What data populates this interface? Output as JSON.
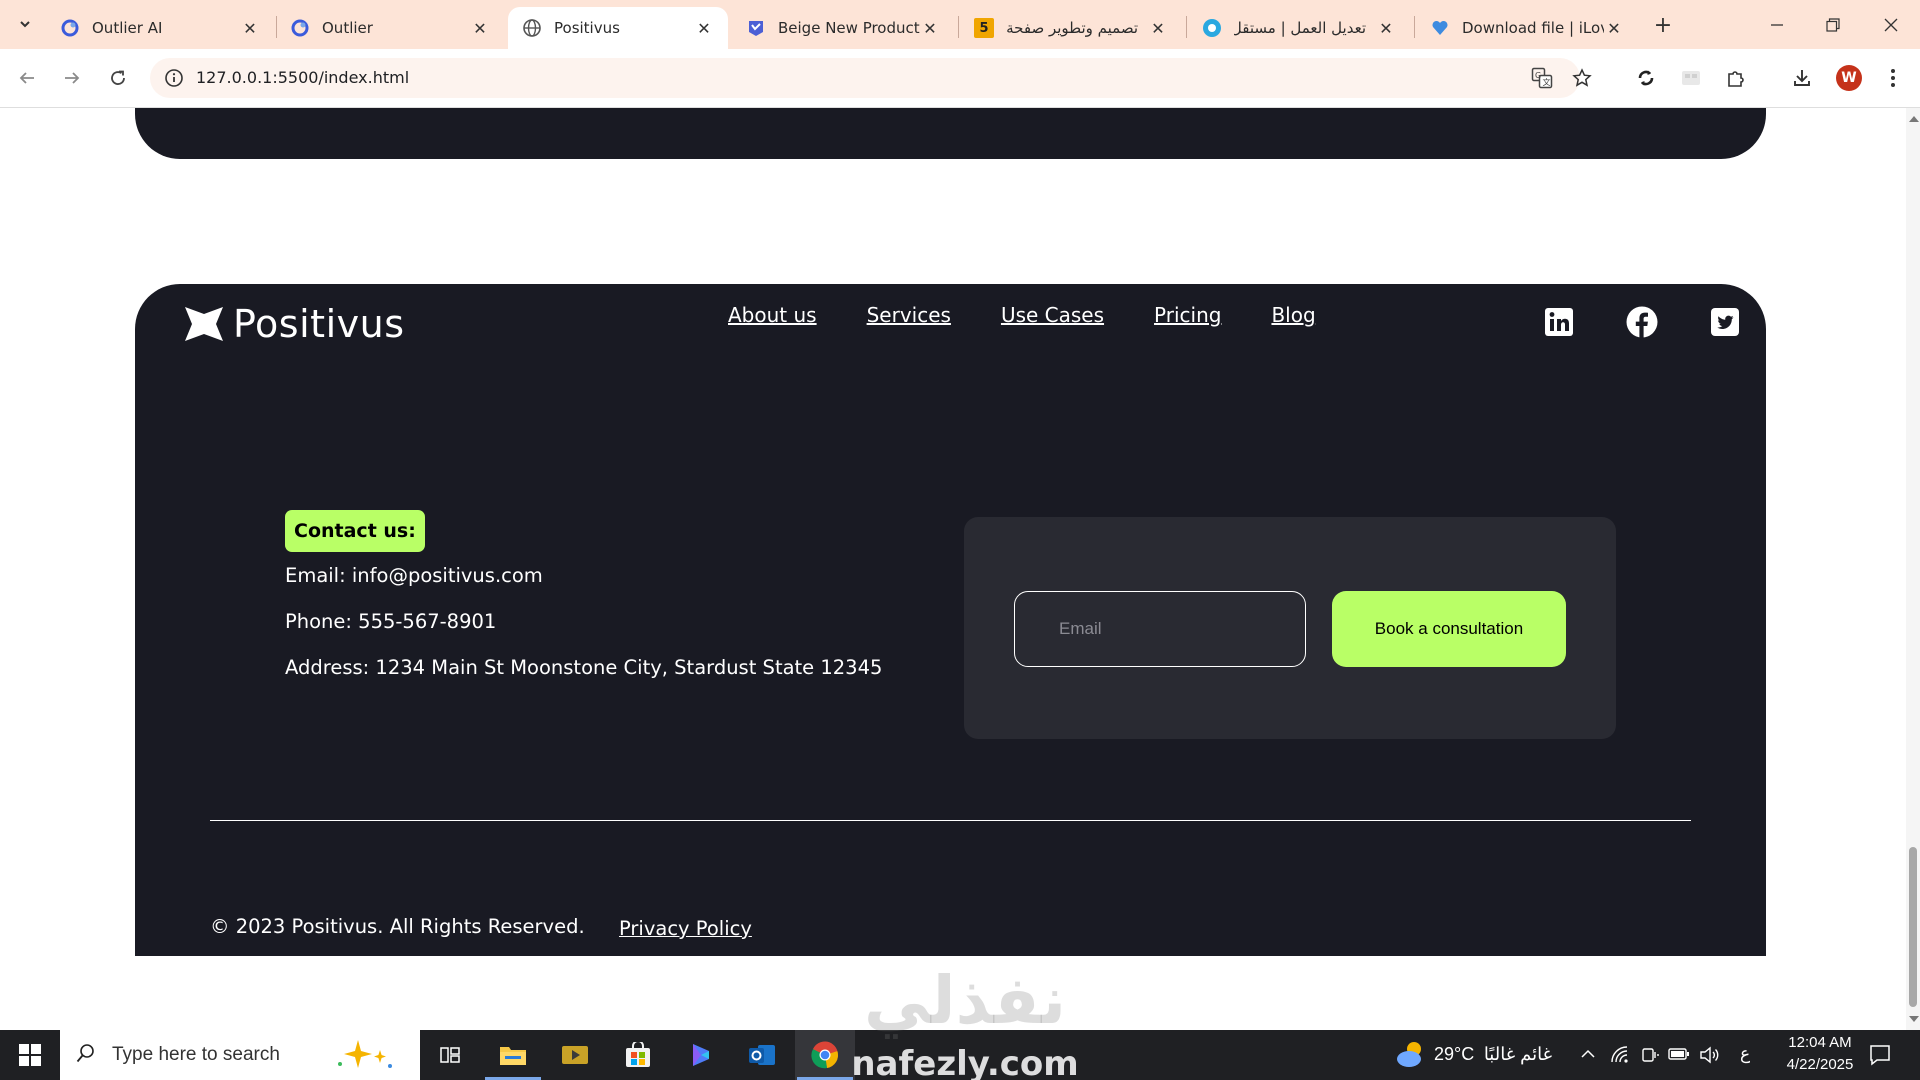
{
  "browser": {
    "tabs": [
      {
        "title": "Outlier AI",
        "favicon": "outlier-icon"
      },
      {
        "title": "Outlier",
        "favicon": "outlier-icon"
      },
      {
        "title": "Positivus",
        "favicon": "globe-icon",
        "active": true
      },
      {
        "title": "Beige New Product N",
        "favicon": "canva-icon"
      },
      {
        "title": "تصميم وتطوير صفحة",
        "favicon": "badge-5-icon",
        "badge": "5"
      },
      {
        "title": "تعديل العمل | مستقل",
        "favicon": "mostaql-icon"
      },
      {
        "title": "Download file | iLove",
        "favicon": "ilovepdf-icon"
      }
    ],
    "url": "127.0.0.1:5500/index.html",
    "profile_initial": "W"
  },
  "page": {
    "logo_text": "Positivus",
    "nav": [
      "About us",
      "Services",
      "Use Cases",
      "Pricing",
      "Blog"
    ],
    "social": [
      "linkedin-icon",
      "facebook-icon",
      "twitter-icon"
    ],
    "contact": {
      "badge": "Contact us:",
      "email": "Email: info@positivus.com",
      "phone": "Phone: 555-567-8901",
      "address": "Address: 1234 Main St Moonstone City, Stardust State 12345"
    },
    "subscribe": {
      "email_placeholder": "Email",
      "button_label": "Book a consultation"
    },
    "copyright": "© 2023 Positivus. All Rights Reserved.",
    "privacy_link": "Privacy Policy"
  },
  "colors": {
    "dark": "#191a23",
    "accent": "#b9ff66",
    "card": "#292a32",
    "tabstrip": "#fde4d7"
  },
  "watermark": {
    "arabic": "نفذلي",
    "latin": "nafezly.com"
  },
  "taskbar": {
    "search_placeholder": "Type here to search",
    "weather_temp": "29°C",
    "weather_desc": "غائم غالبًا",
    "lang": "ع",
    "time": "12:04 AM",
    "date": "4/22/2025"
  }
}
